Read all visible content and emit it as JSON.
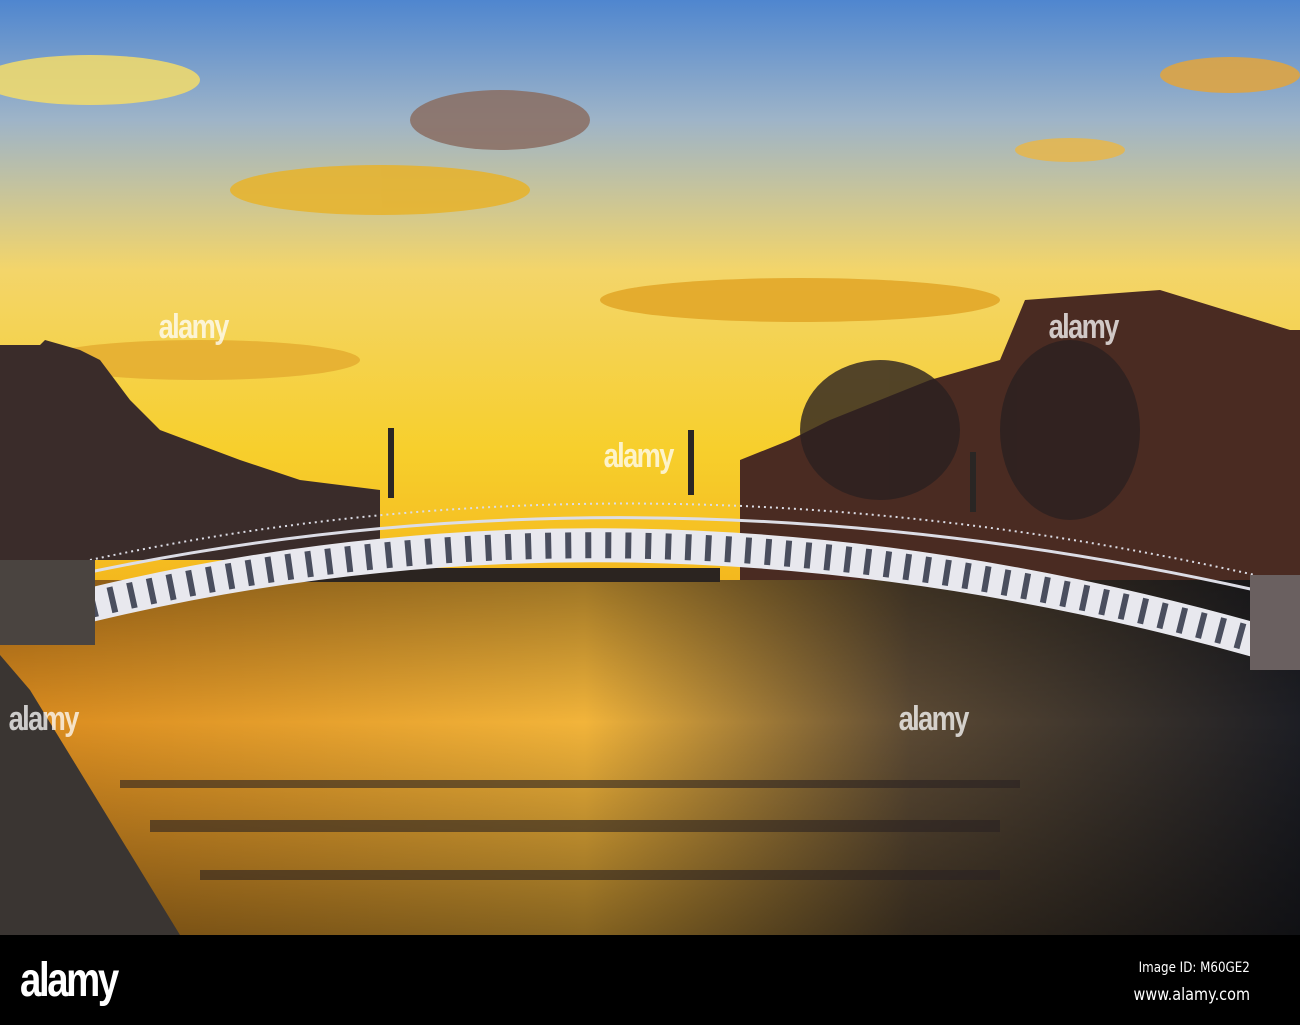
{
  "photo": {
    "subject": "Ha'penny Bridge over the River Liffey at sunset",
    "watermark": "alamy"
  },
  "footer": {
    "logo": "alamy",
    "image_id": "Image ID: M60GE2",
    "website": "www.alamy.com"
  }
}
